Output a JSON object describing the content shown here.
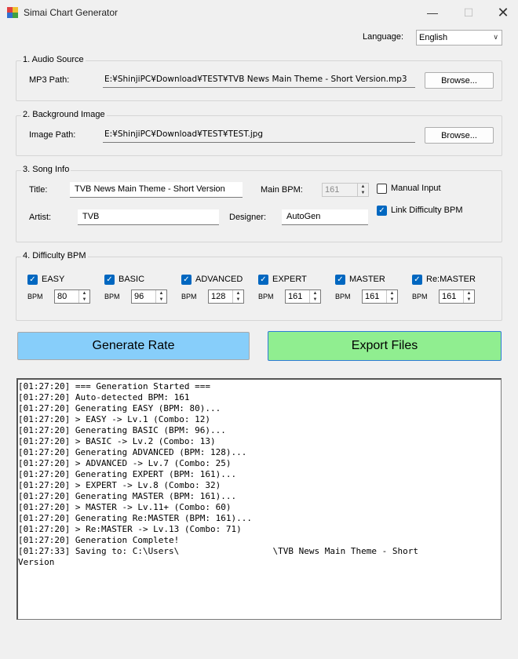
{
  "window": {
    "title": "Simai Chart Generator",
    "controls": {
      "minimize": "—",
      "maximize": "☐",
      "close": "✕"
    },
    "app_icon": "app-icon"
  },
  "language": {
    "label": "Language:",
    "value": "English"
  },
  "audio": {
    "group_label": "1. Audio Source",
    "path_label": "MP3 Path:",
    "path_value": "E:¥ShinjiPC¥Download¥TEST¥TVB News Main Theme - Short Version.mp3",
    "browse_label": "Browse..."
  },
  "image": {
    "group_label": "2. Background Image",
    "path_label": "Image Path:",
    "path_value": "E:¥ShinjiPC¥Download¥TEST¥TEST.jpg",
    "browse_label": "Browse..."
  },
  "song": {
    "group_label": "3. Song Info",
    "title_label": "Title:",
    "title_value": "TVB News Main Theme - Short Version",
    "main_bpm_label": "Main BPM:",
    "main_bpm_value": "161",
    "manual_input_label": "Manual Input",
    "manual_input_checked": false,
    "artist_label": "Artist:",
    "artist_value": "TVB",
    "designer_label": "Designer:",
    "designer_value": "AutoGen",
    "link_bpm_label": "Link Difficulty BPM",
    "link_bpm_checked": true
  },
  "difficulty": {
    "group_label": "4. Difficulty  BPM",
    "items": [
      {
        "name": "EASY",
        "checked": true,
        "bpm_label": "BPM",
        "bpm": "80"
      },
      {
        "name": "BASIC",
        "checked": true,
        "bpm_label": "BPM",
        "bpm": "96"
      },
      {
        "name": "ADVANCED",
        "checked": true,
        "bpm_label": "BPM",
        "bpm": "128"
      },
      {
        "name": "EXPERT",
        "checked": true,
        "bpm_label": "BPM",
        "bpm": "161"
      },
      {
        "name": "MASTER",
        "checked": true,
        "bpm_label": "BPM",
        "bpm": "161"
      },
      {
        "name": "Re:MASTER",
        "checked": true,
        "bpm_label": "BPM",
        "bpm": "161"
      }
    ]
  },
  "actions": {
    "generate_label": "Generate  Rate",
    "export_label": "Export Files",
    "generate_color": "#87cefa",
    "export_color": "#90ee90"
  },
  "log": {
    "lines": [
      "[01:27:20] === Generation Started ===",
      "[01:27:20] Auto-detected BPM: 161",
      "[01:27:20] Generating EASY (BPM: 80)...",
      "[01:27:20] > EASY -> Lv.1 (Combo: 12)",
      "[01:27:20] Generating BASIC (BPM: 96)...",
      "[01:27:20] > BASIC -> Lv.2 (Combo: 13)",
      "[01:27:20] Generating ADVANCED (BPM: 128)...",
      "[01:27:20] > ADVANCED -> Lv.7 (Combo: 25)",
      "[01:27:20] Generating EXPERT (BPM: 161)...",
      "[01:27:20] > EXPERT -> Lv.8 (Combo: 32)",
      "[01:27:20] Generating MASTER (BPM: 161)...",
      "[01:27:20] > MASTER -> Lv.11+ (Combo: 60)",
      "[01:27:20] Generating Re:MASTER (BPM: 161)...",
      "[01:27:20] > Re:MASTER -> Lv.13 (Combo: 71)",
      "[01:27:20] Generation Complete!",
      "[01:27:33] Saving to: C:\\Users\\                  \\TVB News Main Theme - Short",
      "Version"
    ]
  }
}
